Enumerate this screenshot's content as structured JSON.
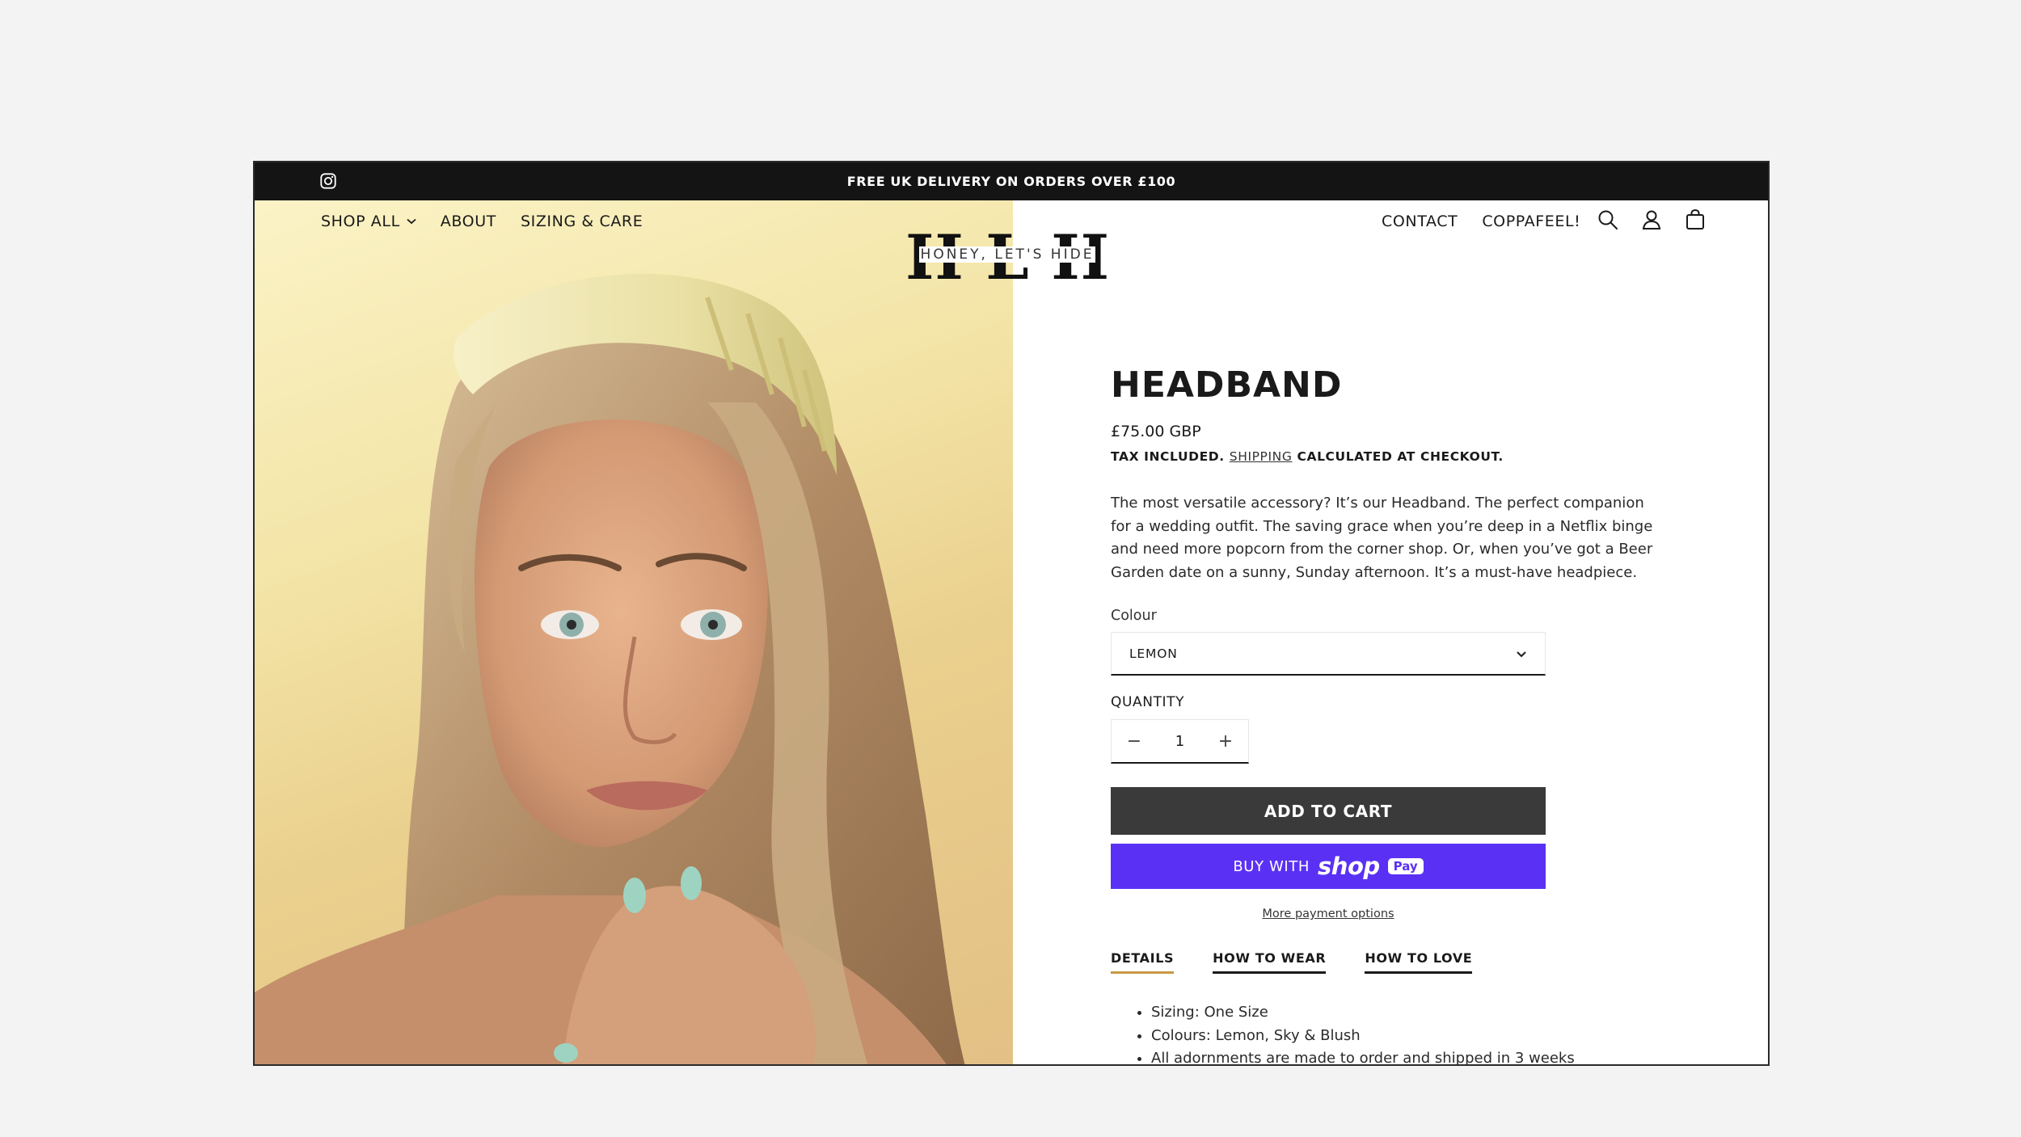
{
  "announcement": {
    "text": "FREE UK DELIVERY ON ORDERS OVER £100",
    "icon": "instagram-icon"
  },
  "nav_left": [
    {
      "label": "SHOP ALL",
      "has_dropdown": true
    },
    {
      "label": "ABOUT"
    },
    {
      "label": "SIZING & CARE"
    }
  ],
  "logo": {
    "letters": [
      "H",
      "L",
      "H"
    ],
    "tagline": "HONEY, LET'S HIDE"
  },
  "nav_right": [
    {
      "label": "CONTACT"
    },
    {
      "label": "COPPAFEEL!"
    }
  ],
  "header_icons": [
    "search-icon",
    "account-icon",
    "cart-icon"
  ],
  "product": {
    "title": "HEADBAND",
    "price": "£75.00 GBP",
    "tax_prefix": "TAX INCLUDED.",
    "tax_link": "SHIPPING",
    "tax_suffix": "CALCULATED AT CHECKOUT.",
    "description": "The most versatile accessory? It’s our Headband. The perfect companion for a wedding outfit. The saving grace when you’re deep in a Netflix binge and need more popcorn from the corner shop. Or, when you’ve got a Beer Garden date on a sunny, Sunday afternoon. It’s a must-have headpiece.",
    "colour_label": "Colour",
    "colour_value": "LEMON",
    "quantity_label": "QUANTITY",
    "quantity_value": "1",
    "quantity_minus": "−",
    "quantity_plus": "+",
    "add_to_cart": "ADD TO CART",
    "buy_with": "BUY WITH",
    "shop_text": "shop",
    "pay_text": "Pay",
    "more_payment": "More payment options",
    "tabs": [
      {
        "label": "DETAILS",
        "active": true
      },
      {
        "label": "HOW TO WEAR",
        "active": false
      },
      {
        "label": "HOW TO LOVE",
        "active": false
      }
    ],
    "details": [
      "Sizing: One Size",
      "Colours: Lemon, Sky & Blush",
      "All adornments are made to order and shipped in 3 weeks"
    ]
  },
  "colors": {
    "announcement_bg": "#141414",
    "add_to_cart_bg": "#3a3a3a",
    "shop_pay_bg": "#5a31f4",
    "active_tab_underline": "#c99844",
    "headband": "#e9e0a4"
  }
}
